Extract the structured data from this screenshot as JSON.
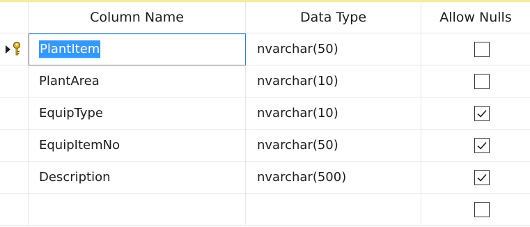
{
  "headers": {
    "column_name": "Column Name",
    "data_type": "Data Type",
    "allow_nulls": "Allow Nulls"
  },
  "rows": [
    {
      "name": "PlantItem",
      "type": "nvarchar(50)",
      "allow_nulls": false,
      "primary_key": true,
      "selected": true
    },
    {
      "name": "PlantArea",
      "type": "nvarchar(10)",
      "allow_nulls": false
    },
    {
      "name": "EquipType",
      "type": "nvarchar(10)",
      "allow_nulls": true
    },
    {
      "name": "EquipItemNo",
      "type": "nvarchar(50)",
      "allow_nulls": true
    },
    {
      "name": "Description",
      "type": "nvarchar(500)",
      "allow_nulls": true
    },
    {
      "name": "",
      "type": "",
      "allow_nulls": false
    }
  ],
  "icons": {
    "row_indicator": "arrow-icon",
    "primary_key": "key-icon",
    "checked": "checkmark-icon"
  },
  "colors": {
    "selection": "#3399ff",
    "focus_border": "#3c7fc3",
    "key": "#d4a017",
    "grid": "#e6e6e6"
  }
}
